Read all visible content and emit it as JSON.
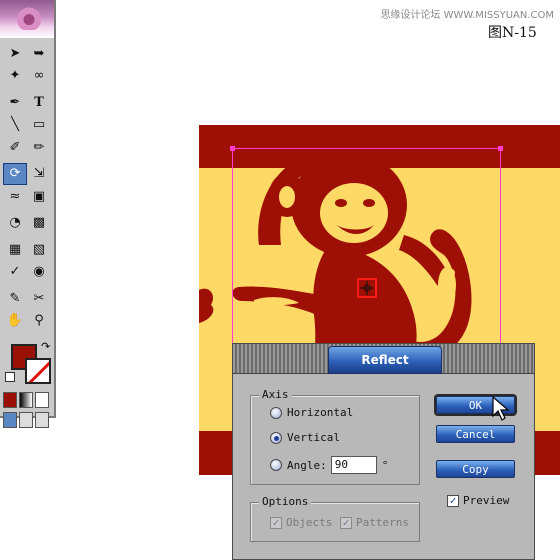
{
  "watermark": "思缘设计论坛 WWW.MISSYUAN.COM",
  "figure_label": "图N-15",
  "toolbox": {
    "tools": [
      [
        "selection-arrow-icon",
        "direct-selection-icon"
      ],
      [
        "magic-wand-icon",
        "lasso-icon"
      ],
      [
        "pen-icon",
        "type-icon"
      ],
      [
        "line-icon",
        "rectangle-icon"
      ],
      [
        "paintbrush-icon",
        "pencil-icon"
      ],
      [
        "rotate-icon",
        "scale-icon"
      ],
      [
        "warp-icon",
        "free-transform-icon"
      ],
      [
        "symbol-sprayer-icon",
        "graph-icon"
      ],
      [
        "mesh-icon",
        "gradient-icon"
      ],
      [
        "eyedropper-icon",
        "blend-icon"
      ],
      [
        "slice-icon",
        "scissors-icon"
      ],
      [
        "hand-icon",
        "zoom-icon"
      ]
    ],
    "selected_tool": "rotate-icon",
    "fill_color": "#9a1004",
    "stroke": "none"
  },
  "artwork": {
    "background_color": "#ffd966",
    "band_color": "#9e1006",
    "selection_color": "#ff3ccf"
  },
  "dialog": {
    "title": "Reflect",
    "axis_group": "Axis",
    "horizontal_label": "Horizontal",
    "vertical_label": "Vertical",
    "angle_label": "Angle:",
    "angle_value": "90",
    "degree_symbol": "°",
    "selected_axis": "vertical",
    "options_group": "Options",
    "objects_label": "Objects",
    "patterns_label": "Patterns",
    "objects_checked": true,
    "patterns_checked": true,
    "ok_label": "OK",
    "cancel_label": "Cancel",
    "copy_label": "Copy",
    "preview_label": "Preview",
    "preview_checked": true
  }
}
